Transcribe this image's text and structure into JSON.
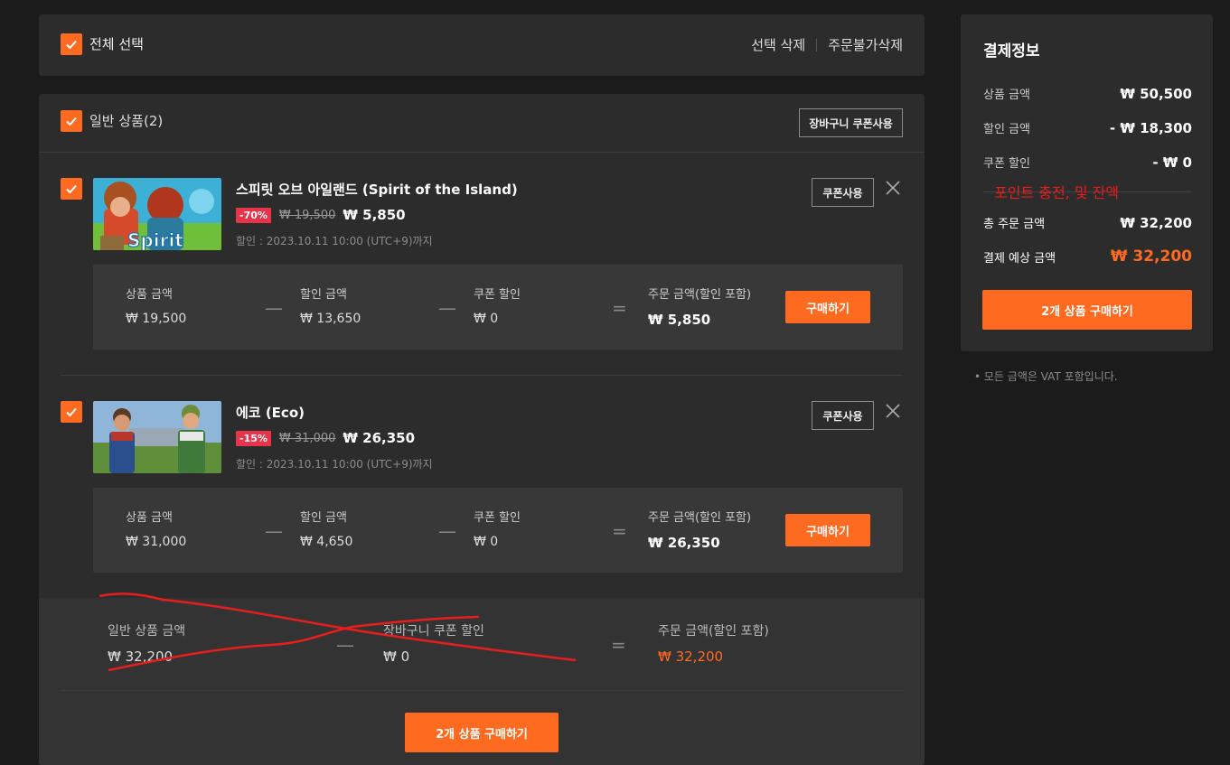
{
  "select_bar": {
    "select_all_label": "전체 선택",
    "delete_selected": "선택 삭제",
    "delete_unorderable": "주문불가삭제"
  },
  "cart_group": {
    "label": "일반 상품(2)",
    "cart_coupon_button": "장바구니 쿠폰사용",
    "items": [
      {
        "title": "스피릿 오브 아일랜드 (Spirit of the Island)",
        "discount_badge": "-70%",
        "original_price": "₩ 19,500",
        "final_price": "₩ 5,850",
        "discount_until": "할인 : 2023.10.11 10:00 (UTC+9)까지",
        "coupon_button": "쿠폰사용",
        "summary": {
          "product_label": "상품 금액",
          "product_value": "₩ 19,500",
          "discount_label": "할인 금액",
          "discount_value": "₩ 13,650",
          "coupon_label": "쿠폰 할인",
          "coupon_value": "₩ 0",
          "order_label": "주문 금액(할인 포함)",
          "order_value": "₩ 5,850"
        },
        "buy_button": "구매하기"
      },
      {
        "title": "에코 (Eco)",
        "discount_badge": "-15%",
        "original_price": "₩ 31,000",
        "final_price": "₩ 26,350",
        "discount_until": "할인 : 2023.10.11 10:00 (UTC+9)까지",
        "coupon_button": "쿠폰사용",
        "summary": {
          "product_label": "상품 금액",
          "product_value": "₩ 31,000",
          "discount_label": "할인 금액",
          "discount_value": "₩ 4,650",
          "coupon_label": "쿠폰 할인",
          "coupon_value": "₩ 0",
          "order_label": "주문 금액(할인 포함)",
          "order_value": "₩ 26,350"
        },
        "buy_button": "구매하기"
      }
    ],
    "group_total": {
      "subtotal_label": "일반 상품 금액",
      "subtotal_value": "₩ 32,200",
      "cart_coupon_label": "장바구니 쿠폰 할인",
      "cart_coupon_value": "₩ 0",
      "order_label": "주문 금액(할인 포함)",
      "order_value": "₩ 32,200"
    },
    "purchase_all_button": "2개 상품 구매하기"
  },
  "payment_info": {
    "title": "결제정보",
    "rows": [
      {
        "label": "상품 금액",
        "value": "₩ 50,500"
      },
      {
        "label": "할인 금액",
        "value": "- ₩ 18,300"
      },
      {
        "label": "쿠폰 할인",
        "value": "- ₩ 0"
      },
      {
        "label": "총 주문 금액",
        "value": "₩ 32,200"
      },
      {
        "label": "결제 예상 금액",
        "value": "₩ 32,200"
      }
    ],
    "annotation": "포인트 충전, 및 잔액",
    "purchase_button": "2개 상품 구매하기",
    "vat_note": "• 모든 금액은 VAT 포함입니다."
  },
  "colors": {
    "accent": "#ff6a21",
    "badge": "#e8334a",
    "annotation_red": "#e81d1d",
    "panel": "#2c2c2c",
    "background": "#1b1b1b"
  }
}
